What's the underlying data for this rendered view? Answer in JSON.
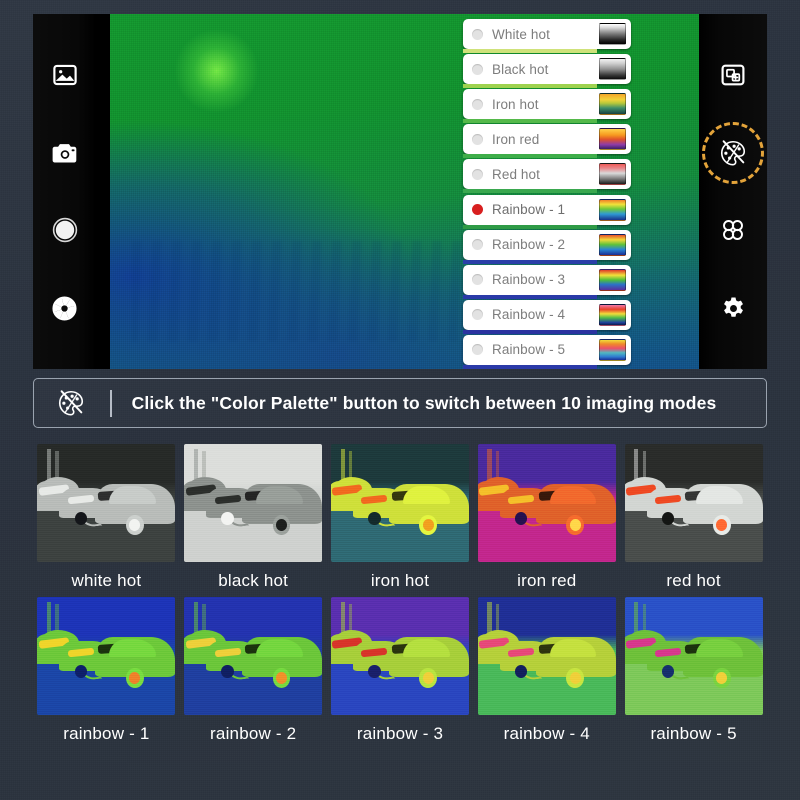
{
  "theme": {
    "page_bg": "#2b3340",
    "device_bg": "#050505",
    "accent_highlight": "#e3a33a",
    "selected_radio": "#d81f1f"
  },
  "left_rail": {
    "items": [
      {
        "name": "gallery-icon",
        "label": "Gallery"
      },
      {
        "name": "camera-icon",
        "label": "Photo"
      },
      {
        "name": "shutter-icon",
        "label": "Shutter"
      },
      {
        "name": "aperture-icon",
        "label": "Aperture"
      }
    ]
  },
  "right_rail": {
    "items": [
      {
        "name": "picture-in-picture-icon",
        "label": "Picture in picture",
        "highlighted": false
      },
      {
        "name": "color-palette-icon",
        "label": "Color Palette",
        "highlighted": true
      },
      {
        "name": "grid-modes-icon",
        "label": "Modes",
        "highlighted": false
      },
      {
        "name": "gear-icon",
        "label": "Settings",
        "highlighted": false
      }
    ]
  },
  "palette_menu": {
    "items": [
      {
        "label": "White hot",
        "selected": false,
        "edge": "#cfe27a",
        "swatch": "linear-gradient(180deg,#ffffff 0%,#d8d8d8 18%,#7d7d7d 48%,#2b2b2b 78%,#000000 100%)"
      },
      {
        "label": "Black hot",
        "selected": false,
        "edge": "#9ed24f",
        "swatch": "linear-gradient(180deg,#f2f2f2 0%,#cfcfcf 22%,#8f8f8f 52%,#3a3a3a 80%,#0c0c0c 100%)"
      },
      {
        "label": "Iron hot",
        "selected": false,
        "edge": "#55b94a",
        "swatch": "linear-gradient(180deg,#f4a62a 0%,#f2d23a 28%,#b8c83a 46%,#3f8f6a 70%,#17413f 100%)"
      },
      {
        "label": "Iron red",
        "selected": false,
        "edge": "#3fae4a",
        "swatch": "linear-gradient(180deg,#ffd24a 0%,#f79a1f 30%,#e0522a 52%,#8e3ba8 78%,#3a1f66 100%)"
      },
      {
        "label": "Red hot",
        "selected": false,
        "edge": "#3aa84f",
        "swatch": "linear-gradient(180deg,#ef5b58 0%,#e8888c 22%,#d9d9d9 46%,#8a8a8a 70%,#1d1d1d 100%)"
      },
      {
        "label": "Rainbow - 1",
        "selected": true,
        "edge": "#2f9b46",
        "swatch": "linear-gradient(180deg,#f0812a 0%,#f2e23a 22%,#6fc93a 45%,#2f9ad4 70%,#19328c 100%)"
      },
      {
        "label": "Rainbow - 2",
        "selected": false,
        "edge": "#2a3fa8",
        "swatch": "linear-gradient(180deg,#e8532a 0%,#f0d83a 24%,#5ec23a 48%,#2a86d4 72%,#1b2f96 100%)"
      },
      {
        "label": "Rainbow - 3",
        "selected": false,
        "edge": "#2a3aa8",
        "swatch": "linear-gradient(180deg,#e03a2a 0%,#f2e03a 26%,#4fbf3a 50%,#2a74c8 72%,#5a2f9e 100%)"
      },
      {
        "label": "Rainbow - 4",
        "selected": false,
        "edge": "#2a33a0",
        "swatch": "linear-gradient(180deg,#f27aa8 0%,#e8412a 22%,#f0dd3a 44%,#4fbd4a 64%,#1f3e9e 88%,#0d1a4a 100%)"
      },
      {
        "label": "Rainbow - 5",
        "selected": false,
        "edge": "#2b3aa8",
        "swatch": "linear-gradient(180deg,#f0dd3a 0%,#ef8a2a 20%,#ec4f6a 42%,#4fb8c2 64%,#2f7ad0 84%,#1b2f96 100%)"
      }
    ]
  },
  "caption": {
    "icon": "color-palette-slash-icon",
    "text": "Click the \"Color Palette\" button to switch between 10 imaging modes"
  },
  "modes_grid": {
    "rows": [
      [
        {
          "label": "white hot",
          "sky": "#272a28",
          "ground": "#3d4240",
          "body": "#b9bdba",
          "hot": "#e8eae7",
          "accent": "#f2f4f1",
          "dark": "#14161a"
        },
        {
          "label": "black hot",
          "sky": "#dcdedb",
          "ground": "#cfd2cf",
          "body": "#8e938f",
          "hot": "#2c2f2c",
          "accent": "#1d1f1d",
          "dark": "#f3f4f2"
        },
        {
          "label": "iron hot",
          "sky": "#1d3a3c",
          "ground": "#2f6a74",
          "body": "#cfe03a",
          "hot": "#f26a1f",
          "accent": "#f2a01f",
          "dark": "#142a2c"
        },
        {
          "label": "iron red",
          "sky": "#4a2a9e",
          "ground": "#c3278e",
          "body": "#e0622a",
          "hot": "#f5c02a",
          "accent": "#ffd84a",
          "dark": "#241050"
        },
        {
          "label": "red hot",
          "sky": "#2a2c2a",
          "ground": "#4a4e4c",
          "body": "#d3d6d3",
          "hot": "#ef4a22",
          "accent": "#ff6a33",
          "dark": "#141614"
        }
      ],
      [
        {
          "label": "rainbow - 1",
          "sky": "#1d34b8",
          "ground": "#1b46a8",
          "body": "#6ec93a",
          "hot": "#f0d52a",
          "accent": "#f0812a",
          "dark": "#0e1f6a"
        },
        {
          "label": "rainbow - 2",
          "sky": "#2333b0",
          "ground": "#1f3fa0",
          "body": "#6cc73a",
          "hot": "#eed03a",
          "accent": "#f0922a",
          "dark": "#101f62"
        },
        {
          "label": "rainbow - 3",
          "sky": "#5a2fb0",
          "ground": "#2a46c0",
          "body": "#a8cf3a",
          "hot": "#d8342a",
          "accent": "#f0d03a",
          "dark": "#1a1f6a"
        },
        {
          "label": "rainbow - 4",
          "sky": "#1f2f96",
          "ground": "#4aba5a",
          "body": "#b6d03a",
          "hot": "#e8487a",
          "accent": "#f0d03a",
          "dark": "#131f5e"
        },
        {
          "label": "rainbow - 5",
          "sky": "#2a52c8",
          "ground": "#7ec95a",
          "body": "#6fc13a",
          "hot": "#d8388e",
          "accent": "#f0d03a",
          "dark": "#16306e"
        }
      ]
    ]
  }
}
